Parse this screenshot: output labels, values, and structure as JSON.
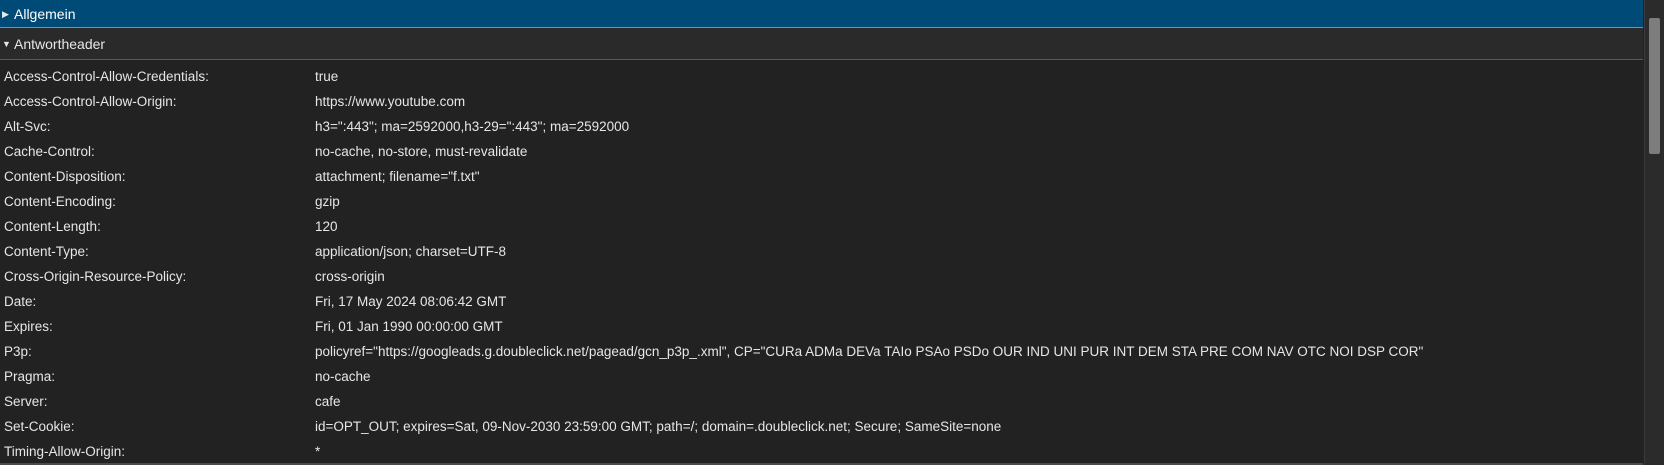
{
  "sections": {
    "general": {
      "label": "Allgemein",
      "collapsed_glyph": "▶"
    },
    "response": {
      "label": "Antwortheader",
      "expanded_glyph": "▼"
    }
  },
  "headers": [
    {
      "name": "Access-Control-Allow-Credentials:",
      "value": "true"
    },
    {
      "name": "Access-Control-Allow-Origin:",
      "value": "https://www.youtube.com"
    },
    {
      "name": "Alt-Svc:",
      "value": "h3=\":443\"; ma=2592000,h3-29=\":443\"; ma=2592000"
    },
    {
      "name": "Cache-Control:",
      "value": "no-cache, no-store, must-revalidate"
    },
    {
      "name": "Content-Disposition:",
      "value": "attachment; filename=\"f.txt\""
    },
    {
      "name": "Content-Encoding:",
      "value": "gzip"
    },
    {
      "name": "Content-Length:",
      "value": "120"
    },
    {
      "name": "Content-Type:",
      "value": "application/json; charset=UTF-8"
    },
    {
      "name": "Cross-Origin-Resource-Policy:",
      "value": "cross-origin"
    },
    {
      "name": "Date:",
      "value": "Fri, 17 May 2024 08:06:42 GMT"
    },
    {
      "name": "Expires:",
      "value": "Fri, 01 Jan 1990 00:00:00 GMT"
    },
    {
      "name": "P3p:",
      "value": "policyref=\"https://googleads.g.doubleclick.net/pagead/gcn_p3p_.xml\", CP=\"CURa ADMa DEVa TAIo PSAo PSDo OUR IND UNI PUR INT DEM STA PRE COM NAV OTC NOI DSP COR\""
    },
    {
      "name": "Pragma:",
      "value": "no-cache"
    },
    {
      "name": "Server:",
      "value": "cafe"
    },
    {
      "name": "Set-Cookie:",
      "value": "id=OPT_OUT; expires=Sat, 09-Nov-2030 23:59:00 GMT; path=/; domain=.doubleclick.net; Secure; SameSite=none"
    },
    {
      "name": "Timing-Allow-Origin:",
      "value": "*"
    }
  ],
  "colors": {
    "general_header_bg": "#004a77",
    "panel_bg": "#222222",
    "text": "#e6e6e6"
  }
}
